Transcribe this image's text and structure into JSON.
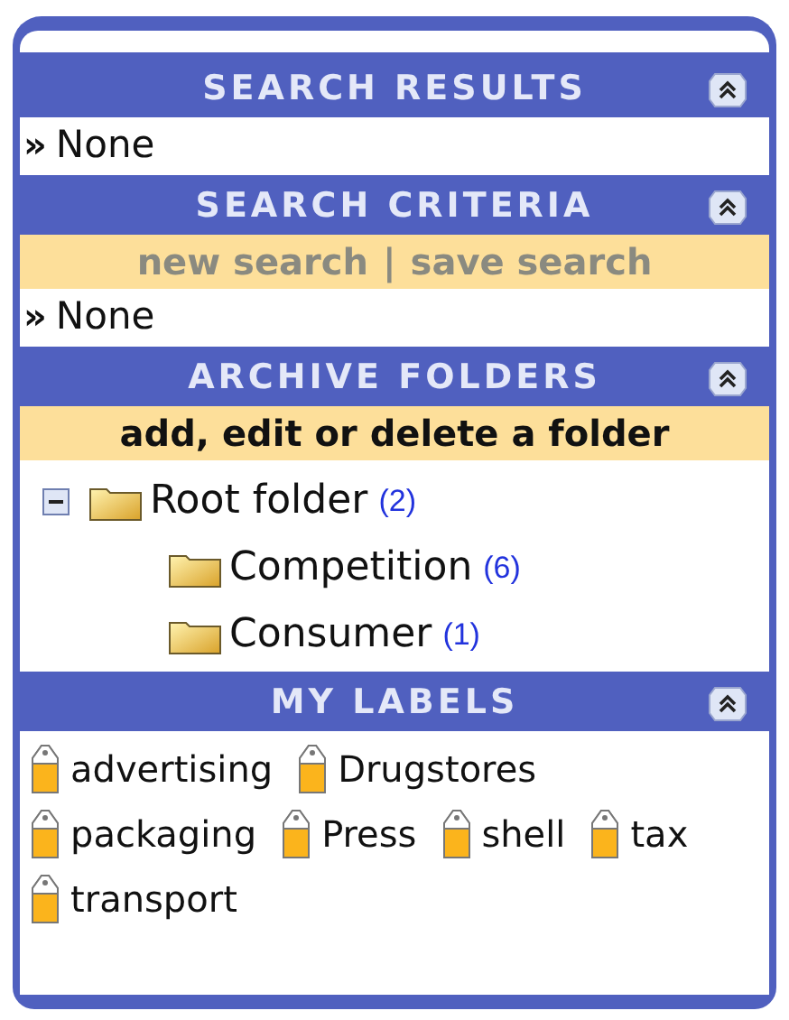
{
  "sections": [
    {
      "title": "SEARCH RESULTS",
      "expanded": true,
      "kind": "list",
      "items": [
        {
          "marker": "»",
          "text": "None"
        }
      ]
    },
    {
      "title": "SEARCH CRITERIA",
      "expanded": true,
      "kind": "list",
      "actions": [
        {
          "label": "new search",
          "disabled": true
        },
        {
          "label": "save search",
          "disabled": true
        }
      ],
      "separator": "|",
      "items": [
        {
          "marker": "»",
          "text": "None"
        }
      ]
    },
    {
      "title": "ARCHIVE FOLDERS",
      "expanded": true,
      "kind": "tree",
      "actions": [
        {
          "label": "add, edit or delete a folder",
          "disabled": false
        }
      ],
      "tree": [
        {
          "name": "Root folder",
          "count": "(2)",
          "expanded": true,
          "children": [
            {
              "name": "Competition",
              "count": "(6)"
            },
            {
              "name": "Consumer",
              "count": "(1)"
            }
          ]
        }
      ]
    },
    {
      "title": "MY LABELS",
      "expanded": true,
      "kind": "labels",
      "labels": [
        "advertising",
        "Drugstores",
        "packaging",
        "Press",
        "shell",
        "tax",
        "transport"
      ]
    }
  ]
}
